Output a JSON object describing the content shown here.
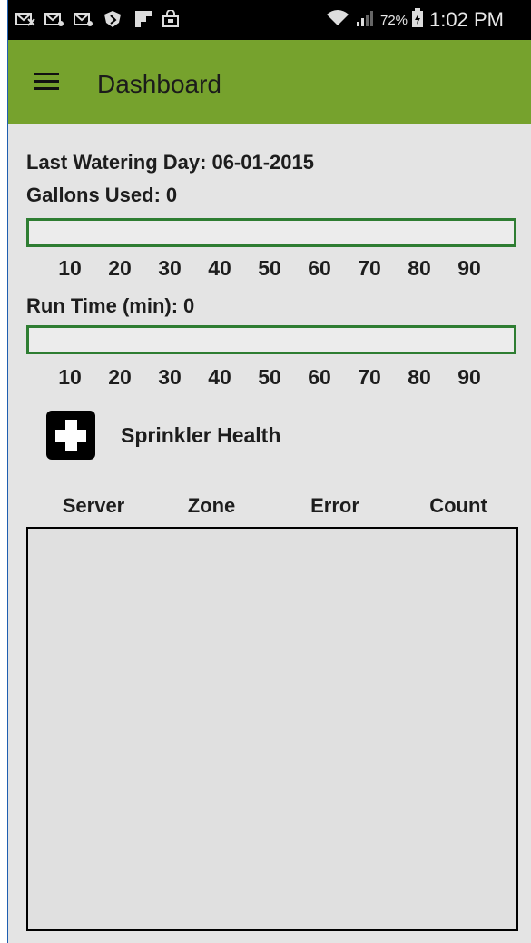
{
  "statusbar": {
    "icons": [
      "mail-x-icon",
      "mail-icon",
      "mail-icon",
      "shield-icon",
      "flipboard-icon",
      "store-bag-icon"
    ],
    "battery_pct": "72%",
    "time": "1:02 PM"
  },
  "appbar": {
    "title": "Dashboard",
    "color": "#76a22d"
  },
  "dashboard": {
    "last_watering_label": "Last Watering Day:",
    "last_watering_value": "06-01-2015",
    "gallons_label": "Gallons Used:",
    "gallons_value": "0",
    "gallons_progress": 0,
    "runtime_label": "Run Time (min):",
    "runtime_value": "0",
    "runtime_progress": 0,
    "scale": [
      "10",
      "20",
      "30",
      "40",
      "50",
      "60",
      "70",
      "80",
      "90"
    ],
    "bar_color": "#2e7d32"
  },
  "health": {
    "label": "Sprinkler Health",
    "icon": "first-aid-icon",
    "columns": [
      "Server",
      "Zone",
      "Error",
      "Count"
    ],
    "rows": []
  }
}
